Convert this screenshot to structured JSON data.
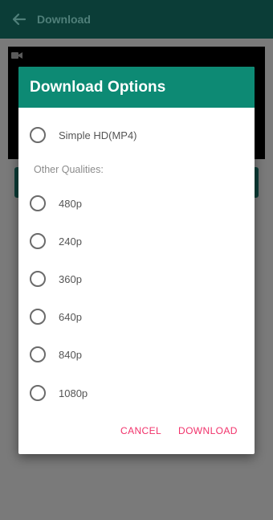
{
  "appbar": {
    "title": "Download"
  },
  "dialog": {
    "title": "Download Options",
    "primary_option": "Simple HD(MP4)",
    "section_label": "Other Qualities:",
    "quality_options": [
      "480p",
      "240p",
      "360p",
      "640p",
      "840p",
      "1080p"
    ],
    "cancel_label": "CANCEL",
    "download_label": "DOWNLOAD"
  },
  "colors": {
    "appbar": "#0b3d37",
    "dialog_header": "#0d8a74",
    "accent": "#f1316a"
  }
}
